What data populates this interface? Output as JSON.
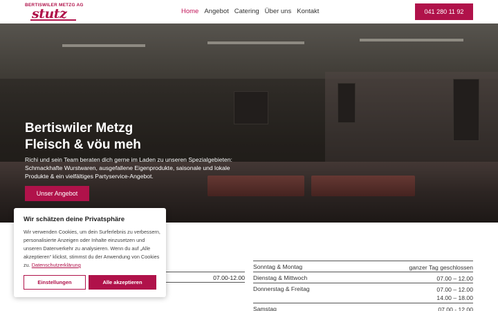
{
  "logo": {
    "company_line": "BERTISWILER METZG AG",
    "wordmark": "stutz"
  },
  "nav": {
    "items": [
      {
        "label": "Home",
        "active": true
      },
      {
        "label": "Angebot",
        "active": false
      },
      {
        "label": "Catering",
        "active": false
      },
      {
        "label": "Über uns",
        "active": false
      },
      {
        "label": "Kontakt",
        "active": false
      }
    ],
    "phone": "041 280 11 92"
  },
  "hero": {
    "title_line1": "Bertiswiler Metzg",
    "title_line2": "Fleisch & vöu meh",
    "text": "Richi und sein Team beraten dich gerne im Laden zu unseren Spezialgebieten: Schmackhafte Wurstwaren, ausgefallene Eigenprodukte, saisonale und lokale Produkte & ein vielfältiges Partyservice-Angebot.",
    "button": "Unser Angebot"
  },
  "hours": {
    "left_partial_time": "07.00-12.00",
    "rows": [
      {
        "day": "Sonntag & Montag",
        "time": "ganzer Tag geschlossen"
      },
      {
        "day": "Dienstag & Mittwoch",
        "time": "07.00 – 12.00"
      },
      {
        "day": "Donnerstag & Freitag",
        "time1": "07.00 – 12.00",
        "time2": "14.00 – 18.00"
      },
      {
        "day": "Samstag",
        "time": "07.00 - 12.00"
      }
    ]
  },
  "cookie": {
    "title": "Wir schätzen deine Privatsphäre",
    "text": "Wir verwenden Cookies, um dein Surferlebnis zu verbessern, personalisierte Anzeigen oder Inhalte einzusetzen und unseren Datenverkehr zu analysieren. Wenn du auf „Alle akzeptieren“ klickst, stimmst du der Anwendung von Cookies zu.",
    "link": "Datenschutzerklärung",
    "settings_button": "Einstellungen",
    "accept_button": "Alle akzeptieren"
  },
  "colors": {
    "brand": "#b0124a",
    "nav_active": "#c2185b"
  }
}
